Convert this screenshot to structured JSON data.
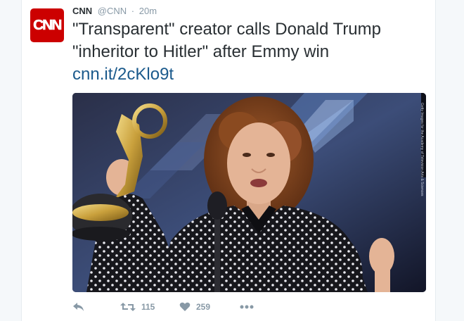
{
  "tweet": {
    "author": {
      "avatar_text": "CNN",
      "name": "CNN",
      "handle": "@CNN",
      "separator": "·",
      "time": "20m"
    },
    "text": "\"Transparent\" creator calls Donald Trump \"inheritor to Hitler\" after Emmy win",
    "link": "cnn.it/2cKlo9t",
    "media": {
      "photo_credit": "Getty Images for the Academy of Television Arts & Sciences"
    },
    "actions": {
      "reply_icon": "reply-icon",
      "retweet_icon": "retweet-icon",
      "retweet_count": "115",
      "like_icon": "heart-icon",
      "like_count": "259",
      "more_icon": "more-icon"
    }
  },
  "colors": {
    "brand": "#cc0000",
    "link": "#1b5a8c",
    "muted": "#8899a6",
    "text": "#292f33"
  }
}
